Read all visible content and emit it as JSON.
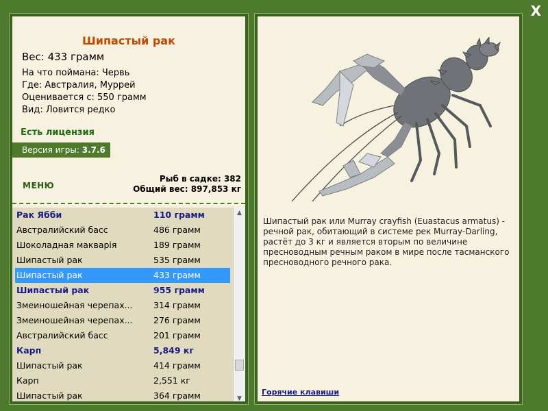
{
  "close": {
    "label": "X"
  },
  "fish": {
    "title": "Шипастый рак",
    "weight": "Вес: 433 грамм",
    "bait": "На что поймана: Червь",
    "location": "Где: Австралия, Муррей",
    "rated": "Оценивается с: 550 грамм",
    "kind": "Вид: Ловится редко",
    "description": "Шипастый рак или Murray crayfish (Euastacus armatus) - речной рак, обитающий в системе рек Murray-Darling, растёт до 3 кг и является вторым по величине пресноводным речным раком в мире после тасманского пресноводного речного рака."
  },
  "license": "Есть лицензия",
  "version": {
    "label": "Версия игры:",
    "value": "3.7.6"
  },
  "menu": "МЕНЮ",
  "totals": {
    "fish_count": "Рыб в садке: 382",
    "total_weight": "Общий вес: 897,853 кг"
  },
  "catch_list": [
    {
      "name": "Рак Ябби",
      "weight": "110 грамм",
      "bold": true
    },
    {
      "name": "Австралийский басс",
      "weight": "486 грамм"
    },
    {
      "name": "Шоколадная макварія",
      "weight": "189 грамм"
    },
    {
      "name": "Шипастый рак",
      "weight": "535 грамм"
    },
    {
      "name": "Шипастый рак",
      "weight": "433 грамм",
      "selected": true
    },
    {
      "name": "Шипастый рак",
      "weight": "955 грамм",
      "bold": true
    },
    {
      "name": "Змеиношейная черепах...",
      "weight": "314 грамм"
    },
    {
      "name": "Змеиношейная черепах...",
      "weight": "276 грамм"
    },
    {
      "name": "Австралийский басс",
      "weight": "201 грамм"
    },
    {
      "name": "Карп",
      "weight": "5,849 кг",
      "bold": true
    },
    {
      "name": "Шипастый рак",
      "weight": "414 грамм"
    },
    {
      "name": "Карп",
      "weight": "2,551 кг"
    },
    {
      "name": "Шипастый рак",
      "weight": "364 грамм"
    }
  ],
  "hotkeys": "Горячие клавиши",
  "colors": {
    "background": "#4e7a2e",
    "panel": "#f6f2df",
    "title": "#c24a00",
    "selected": "#3399ff",
    "bold_row": "#1b1c8a"
  }
}
